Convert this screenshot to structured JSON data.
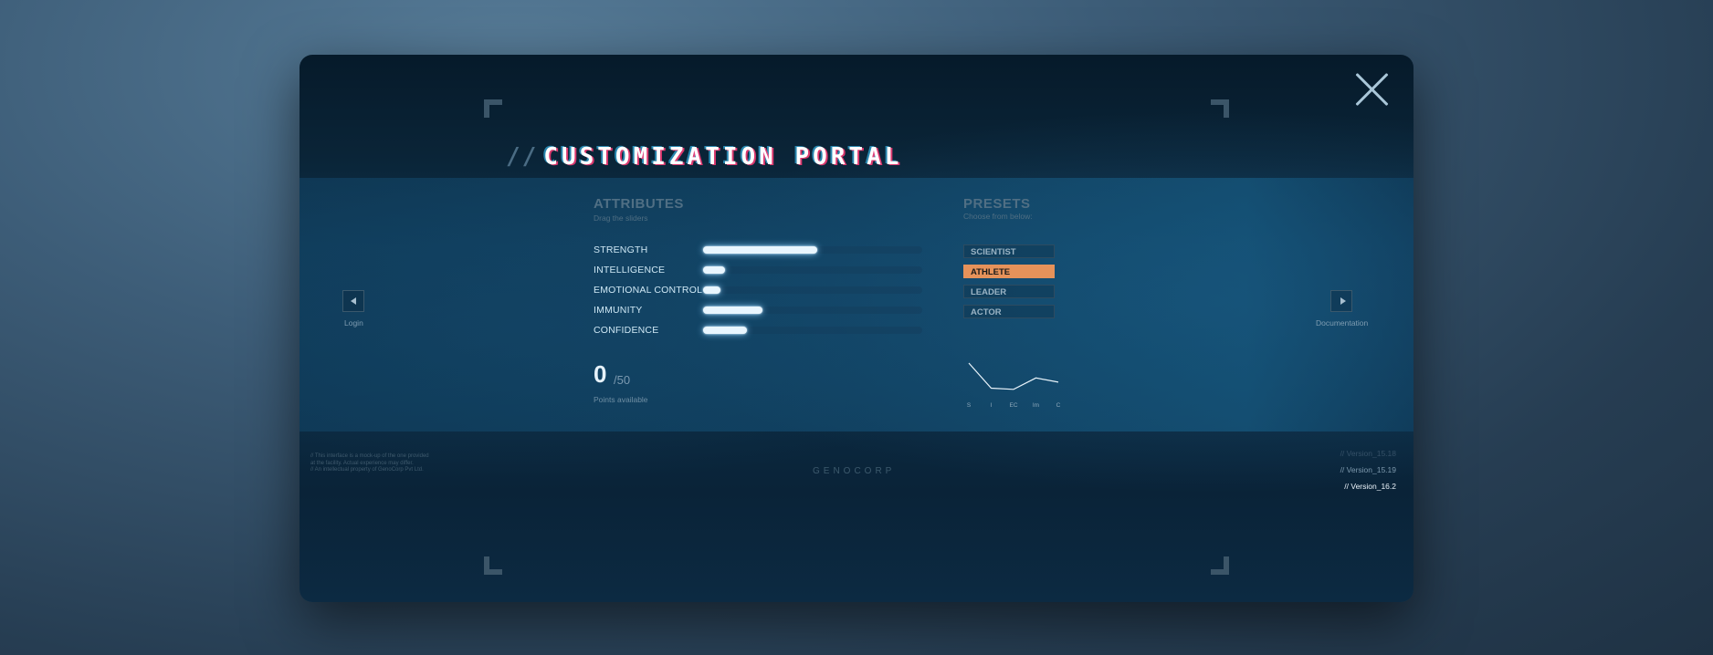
{
  "portal": {
    "title_prefix": "//",
    "title": "CUSTOMIZATION PORTAL"
  },
  "attributes": {
    "heading": "ATTRIBUTES",
    "subheading": "Drag the sliders",
    "items": [
      {
        "label": "STRENGTH",
        "value": 0.52
      },
      {
        "label": "INTELLIGENCE",
        "value": 0.1
      },
      {
        "label": "EMOTIONAL CONTROL",
        "value": 0.08
      },
      {
        "label": "IMMUNITY",
        "value": 0.27
      },
      {
        "label": "CONFIDENCE",
        "value": 0.2
      }
    ],
    "points_value": "0",
    "points_total": "/50",
    "points_label": "Points available"
  },
  "presets": {
    "heading": "PRESETS",
    "subheading": "Choose from below:",
    "items": [
      "SCIENTIST",
      "ATHLETE",
      "LEADER",
      "ACTOR"
    ],
    "selected": "ATHLETE",
    "accent_color": "#e6925a"
  },
  "chart_data": {
    "type": "line",
    "categories": [
      "S",
      "I",
      "EC",
      "Im",
      "C"
    ],
    "values": [
      0.52,
      0.1,
      0.08,
      0.27,
      0.2
    ],
    "title": "",
    "xlabel": "",
    "ylabel": "",
    "ylim": [
      0,
      0.55
    ],
    "grid": false
  },
  "nav": {
    "left_label": "Login",
    "right_label": "Documentation",
    "left_icon": "triangle-left-icon",
    "right_icon": "triangle-right-icon"
  },
  "footer": {
    "disclaimer": [
      "// This interface is a mock-up of the one provided at the facility. Actual experience may differ.",
      "// An intellectual property of GenoCorp Pvt Ltd."
    ],
    "brand": "GENOCORP",
    "versions": [
      "// Version_15.18",
      "// Version_15.19",
      "// Version_16.2"
    ],
    "active_version": "// Version_16.2"
  },
  "icons": {
    "close": "close-icon"
  }
}
